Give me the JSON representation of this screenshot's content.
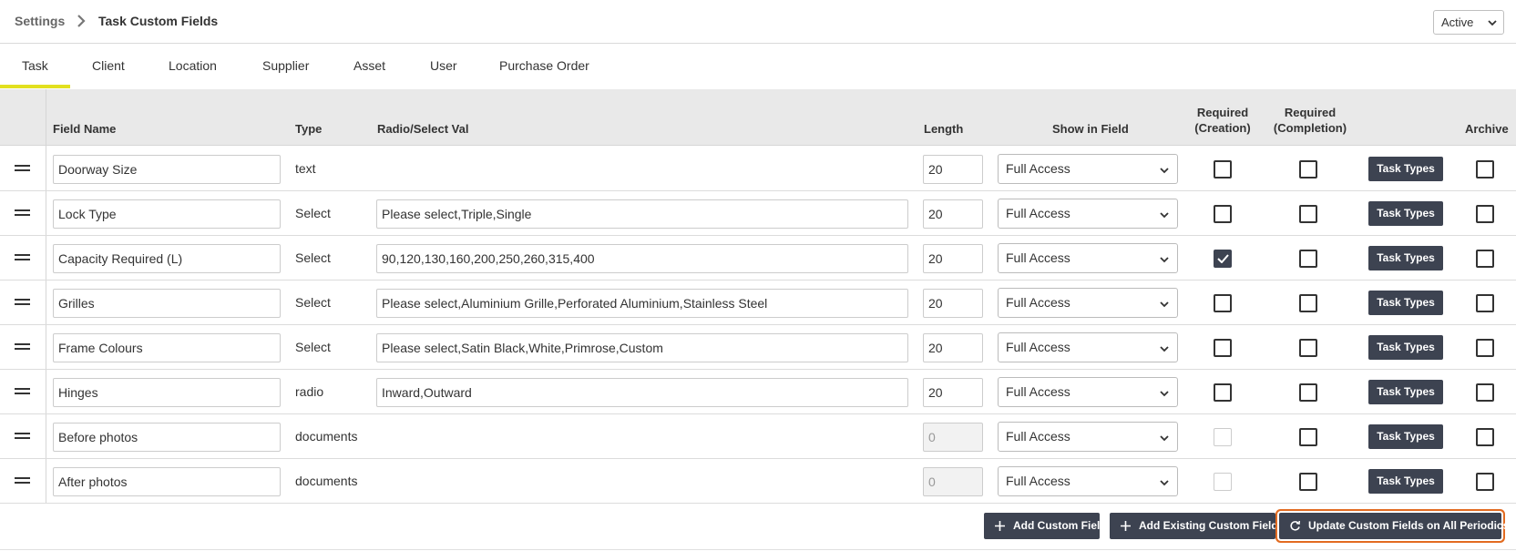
{
  "breadcrumb": {
    "root": "Settings",
    "current": "Task Custom Fields"
  },
  "status_filter": {
    "value": "Active"
  },
  "tabs": [
    {
      "label": "Task",
      "active": true
    },
    {
      "label": "Client"
    },
    {
      "label": "Location"
    },
    {
      "label": "Supplier"
    },
    {
      "label": "Asset"
    },
    {
      "label": "User"
    },
    {
      "label": "Purchase Order"
    }
  ],
  "columns": {
    "field_name": "Field Name",
    "type": "Type",
    "values": "Radio/Select Val",
    "length": "Length",
    "show_in_field": "Show in Field",
    "req_creation_1": "Required",
    "req_creation_2": "(Creation)",
    "req_completion_1": "Required",
    "req_completion_2": "(Completion)",
    "archive": "Archive"
  },
  "rows": [
    {
      "name": "Doorway Size",
      "type": "text",
      "values": "",
      "length": "20",
      "show": "Full Access",
      "req_creation": false,
      "req_completion": false,
      "task_types": "Task Types",
      "archive": false
    },
    {
      "name": "Lock Type",
      "type": "Select",
      "values": "Please select,Triple,Single",
      "length": "20",
      "show": "Full Access",
      "req_creation": false,
      "req_completion": false,
      "task_types": "Task Types",
      "archive": false
    },
    {
      "name": "Capacity Required (L)",
      "type": "Select",
      "values": "90,120,130,160,200,250,260,315,400",
      "length": "20",
      "show": "Full Access",
      "req_creation": true,
      "req_completion": false,
      "task_types": "Task Types",
      "archive": false
    },
    {
      "name": "Grilles",
      "type": "Select",
      "values": "Please select,Aluminium Grille,Perforated Aluminium,Stainless Steel",
      "length": "20",
      "show": "Full Access",
      "req_creation": false,
      "req_completion": false,
      "task_types": "Task Types",
      "archive": false
    },
    {
      "name": "Frame Colours",
      "type": "Select",
      "values": "Please select,Satin Black,White,Primrose,Custom",
      "length": "20",
      "show": "Full Access",
      "req_creation": false,
      "req_completion": false,
      "task_types": "Task Types",
      "archive": false
    },
    {
      "name": "Hinges",
      "type": "radio",
      "values": "Inward,Outward",
      "length": "20",
      "show": "Full Access",
      "req_creation": false,
      "req_completion": false,
      "task_types": "Task Types",
      "archive": false
    },
    {
      "name": "Before photos",
      "type": "documents",
      "values": "",
      "length": "0",
      "show": "Full Access",
      "req_creation": false,
      "req_creation_disabled": true,
      "req_completion": false,
      "task_types": "Task Types",
      "archive": false
    },
    {
      "name": "After photos",
      "type": "documents",
      "values": "",
      "length": "0",
      "show": "Full Access",
      "req_creation": false,
      "req_creation_disabled": true,
      "req_completion": false,
      "task_types": "Task Types",
      "archive": false
    }
  ],
  "footer": {
    "add_custom_field": "Add Custom Field",
    "add_existing_custom_field": "Add Existing Custom Field",
    "update_periodics": "Update Custom Fields on All Periodics"
  },
  "colors": {
    "accent": "#e2e01f",
    "button": "#3d4351",
    "focus_ring": "#e26b21"
  }
}
